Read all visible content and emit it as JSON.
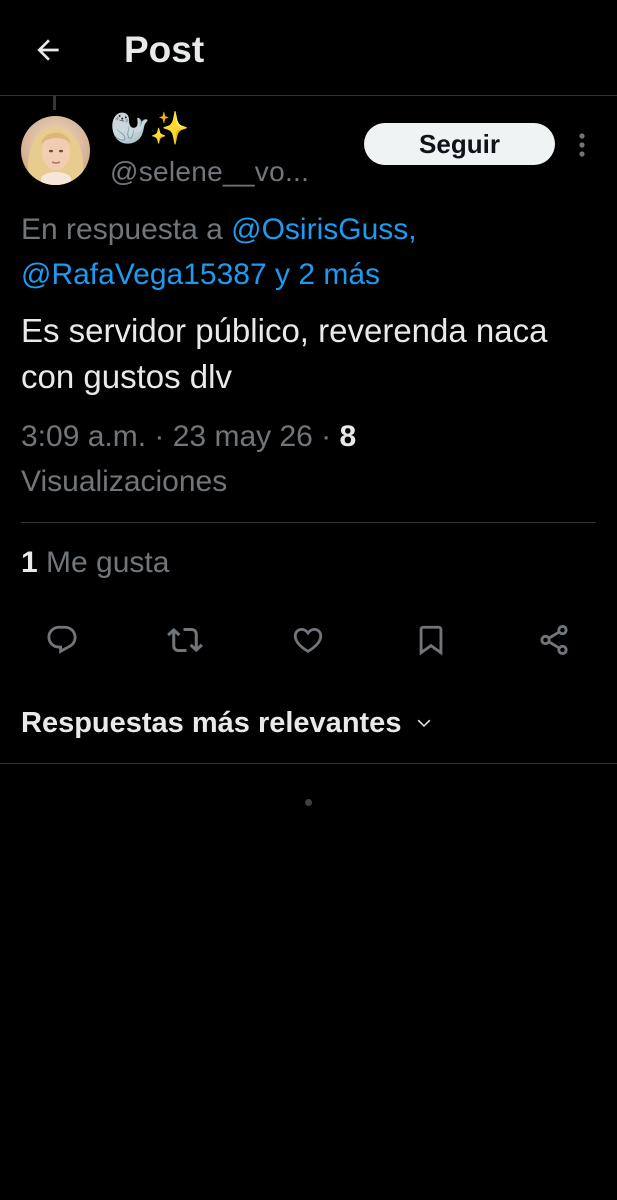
{
  "header": {
    "title": "Post",
    "back_icon": "arrow-left-icon"
  },
  "author": {
    "display_name": "🦭✨",
    "handle": "@selene__vo...",
    "follow_label": "Seguir",
    "more_icon": "more-vertical-icon"
  },
  "reply": {
    "prefix": "En respuesta a ",
    "mention_1": "@OsirisGuss,",
    "mention_2": "@RafaVega15387",
    "and_more": " y 2 más"
  },
  "tweet": {
    "text": "Es servidor público, reverenda naca con gustos dlv"
  },
  "meta": {
    "time": "3:09 a.m.",
    "sep": " · ",
    "date": "23 may 26",
    "views_count": "8",
    "views_label": "Visualizaciones"
  },
  "likes": {
    "count": "1",
    "label": " Me gusta"
  },
  "actions": [
    "reply-icon",
    "retweet-icon",
    "like-icon",
    "bookmark-icon",
    "share-icon"
  ],
  "sort": {
    "label": "Respuestas más relevantes",
    "icon": "chevron-down-icon"
  },
  "colors": {
    "background": "#000000",
    "text": "#e7e9ea",
    "secondary": "#71767b",
    "accent": "#1d9bf0",
    "divider": "#2f3336"
  }
}
